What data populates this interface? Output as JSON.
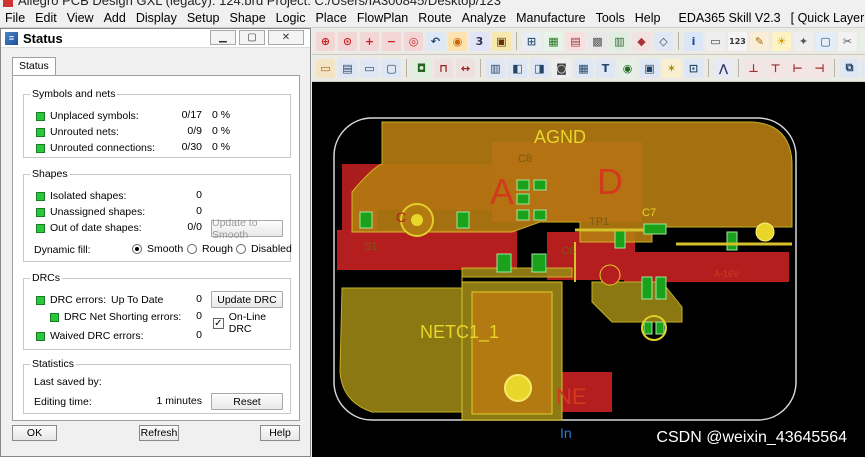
{
  "titlebar": {
    "text": "Allegro PCB Design GXL (legacy): 124.brd  Project: C:/Users/IA300845/Desktop/123"
  },
  "menu": [
    "File",
    "Edit",
    "View",
    "Add",
    "Display",
    "Setup",
    "Shape",
    "Logic",
    "Place",
    "FlowPlan",
    "Route",
    "Analyze",
    "Manufacture",
    "Tools",
    "Help"
  ],
  "menu_right": [
    "EDA365 Skill V2.3",
    "[ Quick Layer ]"
  ],
  "status_window": {
    "title": "Status",
    "tab": "Status",
    "symbols_nets": {
      "label": "Symbols and nets",
      "rows": [
        {
          "label": "Unplaced symbols:",
          "count": "0/17",
          "pct": "0 %"
        },
        {
          "label": "Unrouted nets:",
          "count": "0/9",
          "pct": "0 %"
        },
        {
          "label": "Unrouted connections:",
          "count": "0/30",
          "pct": "0 %"
        }
      ]
    },
    "shapes": {
      "label": "Shapes",
      "rows": [
        {
          "label": "Isolated shapes:",
          "value": "0"
        },
        {
          "label": "Unassigned shapes:",
          "value": "0"
        },
        {
          "label": "Out of date shapes:",
          "value": "0/0"
        }
      ],
      "update_smooth": "Update to Smooth",
      "dynamic_fill": "Dynamic fill:",
      "fill_options": [
        "Smooth",
        "Rough",
        "Disabled"
      ],
      "fill_selected": "Smooth"
    },
    "drcs": {
      "label": "DRCs",
      "rows": [
        {
          "label": "DRC errors:",
          "sub": "Up To Date",
          "value": "0"
        },
        {
          "label": "DRC Net Shorting errors:",
          "value": "0"
        },
        {
          "label": "Waived DRC errors:",
          "value": "0"
        }
      ],
      "update_drc": "Update DRC",
      "online_drc": "On-Line DRC",
      "online_checked": true
    },
    "statistics": {
      "label": "Statistics",
      "last_saved": "Last saved by:",
      "editing_time": "Editing time:",
      "editing_value": "1 minutes",
      "reset": "Reset"
    },
    "buttons": {
      "ok": "OK",
      "refresh": "Refresh",
      "help": "Help"
    }
  },
  "pcb": {
    "labels": {
      "agnd": "AGND",
      "netc1": "NETC1_1",
      "c8": "C8",
      "c7": "C7",
      "tp1": "TP1",
      "in": "In",
      "a_big": "A",
      "d_big": "D",
      "ne": "NE",
      "a16v": "A-16V",
      "s1": "S1",
      "c6": "C6",
      "c_left": "C"
    }
  },
  "watermark": "CSDN @weixin_43645564"
}
